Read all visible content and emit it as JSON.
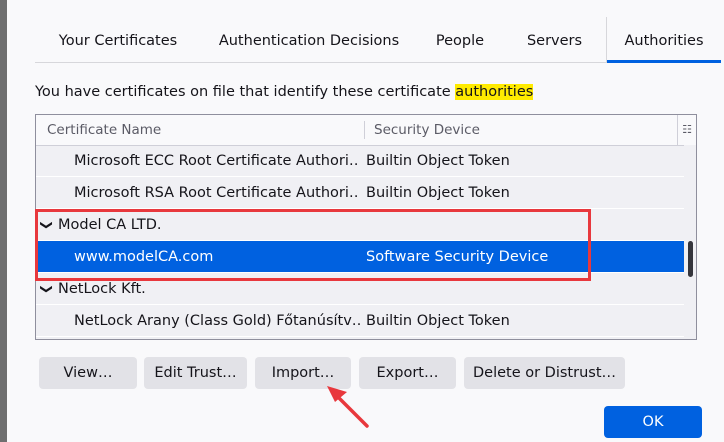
{
  "tabs": {
    "your_certificates": "Your Certificates",
    "authentication_decisions": "Authentication Decisions",
    "people": "People",
    "servers": "Servers",
    "authorities": "Authorities"
  },
  "description": {
    "prefix": "You have certificates on file that identify these certificate ",
    "highlight": "authorities"
  },
  "tree": {
    "col_name": "Certificate Name",
    "col_device": "Security Device",
    "rows": [
      {
        "name": "Microsoft ECC Root Certificate Authori…",
        "device": "Builtin Object Token"
      },
      {
        "name": "Microsoft RSA Root Certificate Authori…",
        "device": "Builtin Object Token"
      },
      {
        "name": "Model CA LTD.",
        "device": ""
      },
      {
        "name": "www.modelCA.com",
        "device": "Software Security Device"
      },
      {
        "name": "NetLock Kft.",
        "device": ""
      },
      {
        "name": "NetLock Arany (Class Gold) Főtanúsítv…",
        "device": "Builtin Object Token"
      }
    ]
  },
  "buttons": {
    "view": "View…",
    "edit_trust": "Edit Trust…",
    "import": "Import…",
    "export": "Export…",
    "delete": "Delete or Distrust…",
    "ok": "OK"
  },
  "colors": {
    "accent": "#0061e0",
    "highlight": "#ffeb00",
    "annotation": "#e8383d"
  }
}
